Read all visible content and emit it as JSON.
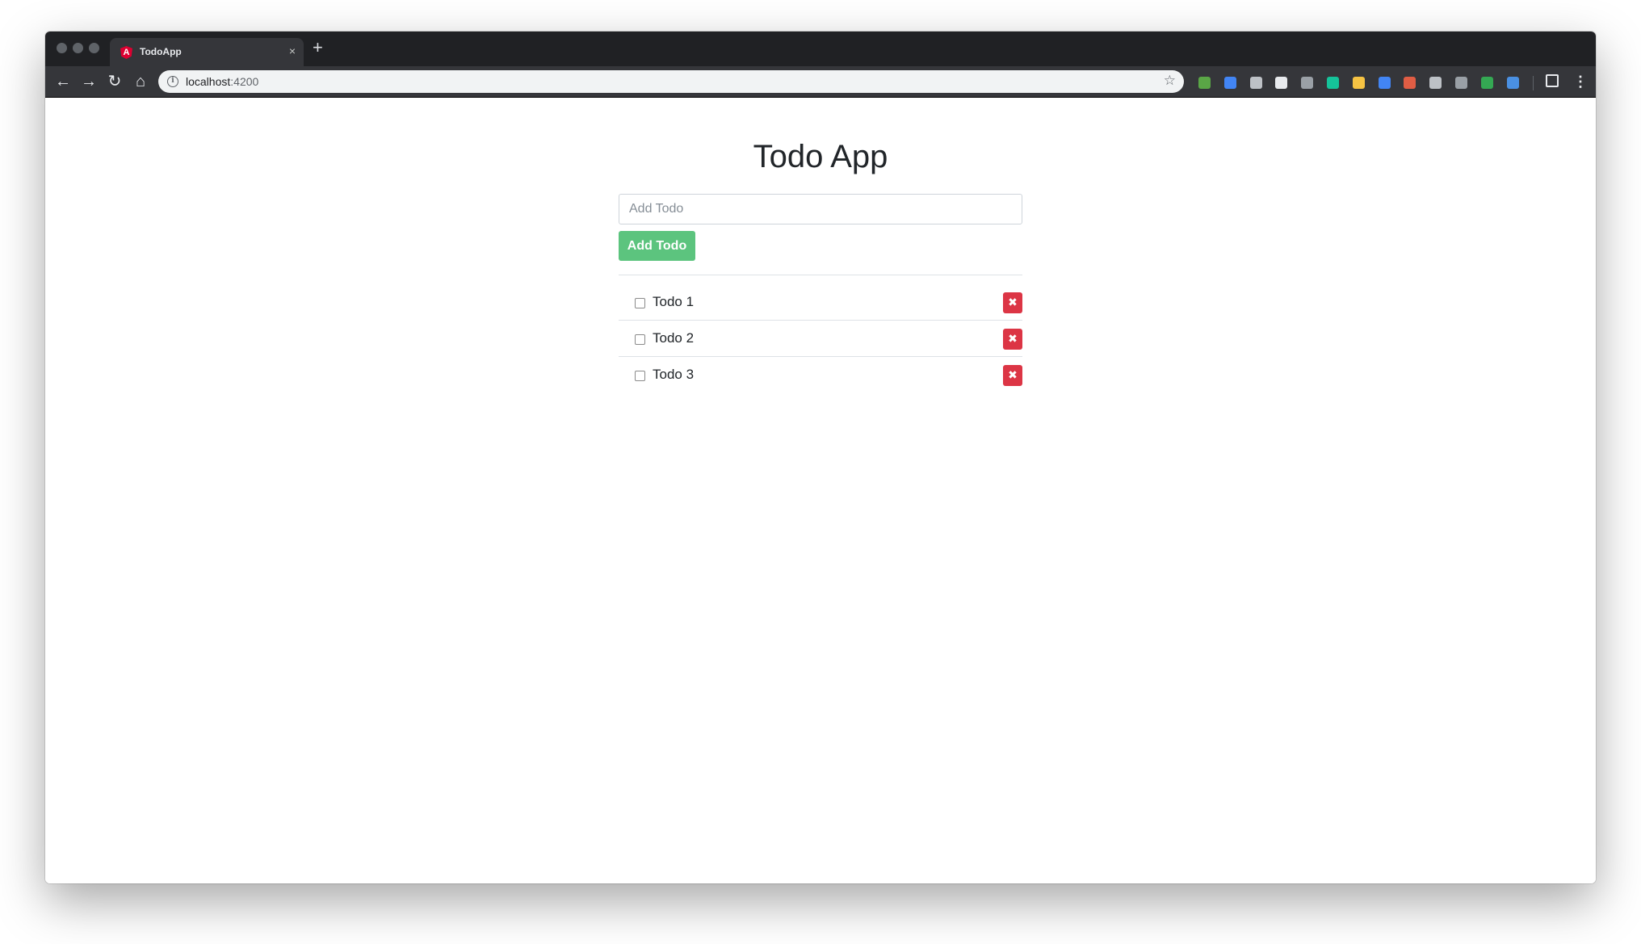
{
  "browser": {
    "tab_title": "TodoApp",
    "tab_close": "×",
    "new_tab": "+",
    "url_host": "localhost",
    "url_port": ":4200",
    "info_glyph": "i",
    "star_glyph": "☆",
    "nav": {
      "back": "←",
      "forward": "→",
      "reload": "↻",
      "home": "⌂"
    },
    "extensions": [
      {
        "name": "node-ext-icon",
        "color": "#5aa646"
      },
      {
        "name": "pen-ext-icon",
        "color": "#4285f4"
      },
      {
        "name": "camera-ext-icon",
        "color": "#bdc1c6"
      },
      {
        "name": "react-ext-icon",
        "color": "#e8eaed"
      },
      {
        "name": "code-ext-icon",
        "color": "#9aa0a6"
      },
      {
        "name": "grammarly-ext-icon",
        "color": "#15c39a"
      },
      {
        "name": "note-ext-icon",
        "color": "#f6c343"
      },
      {
        "name": "square-ext-icon",
        "color": "#4285f4"
      },
      {
        "name": "asterisk-ext-icon",
        "color": "#e05d44"
      },
      {
        "name": "vue-ext-icon",
        "color": "#bdc1c6"
      },
      {
        "name": "lock-ext-icon",
        "color": "#9aa0a6"
      },
      {
        "name": "color-ext-icon",
        "color": "#34a853"
      },
      {
        "name": "window-ext-icon",
        "color": "#4a90e2"
      }
    ],
    "menu_glyph": "⋮"
  },
  "app": {
    "title": "Todo App",
    "input_placeholder": "Add Todo",
    "add_button_label": "Add Todo",
    "delete_glyph": "✖",
    "todos": [
      {
        "label": "Todo 1",
        "done": false
      },
      {
        "label": "Todo 2",
        "done": false
      },
      {
        "label": "Todo 3",
        "done": false
      }
    ]
  },
  "colors": {
    "add_button": "#5cc47e",
    "delete_button": "#dc3545"
  }
}
